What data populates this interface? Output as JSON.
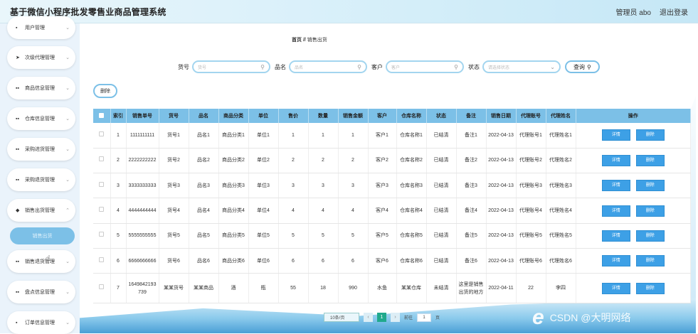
{
  "header": {
    "title": "基于微信小程序批发零售业商品管理系统",
    "admin": "管理员 abo",
    "logout": "退出登录"
  },
  "sidebar": {
    "items": [
      {
        "label": "用户管理",
        "icon": "user-icon",
        "glyph": "▪"
      },
      {
        "label": "次级代理管理",
        "icon": "paper-plane-icon",
        "glyph": "➤"
      },
      {
        "label": "商品信息管理",
        "icon": "grid-icon",
        "glyph": "▪▪"
      },
      {
        "label": "仓库信息管理",
        "icon": "grid-icon",
        "glyph": "▪▪"
      },
      {
        "label": "采购进货管理",
        "icon": "grid-icon",
        "glyph": "▪▪"
      },
      {
        "label": "采购退货管理",
        "icon": "grid-icon",
        "glyph": "▪▪"
      },
      {
        "label": "销售出货管理",
        "icon": "thumbs-up-icon",
        "glyph": "◆"
      },
      {
        "label": "销售退货管理",
        "icon": "grid-icon",
        "glyph": "▪▪"
      },
      {
        "label": "盘点信息管理",
        "icon": "grid-icon",
        "glyph": "▪▪"
      },
      {
        "label": "订单信息管理",
        "icon": "doc-icon",
        "glyph": "▪"
      }
    ],
    "active_sub": "销售出货"
  },
  "breadcrumb": {
    "home": "首页",
    "sep": "//",
    "current": "销售出货"
  },
  "search": {
    "f1_label": "货号",
    "f1_placeholder": "货号",
    "f2_label": "品名",
    "f2_placeholder": "品名",
    "f3_label": "客户",
    "f3_placeholder": "客户",
    "f4_label": "状态",
    "f4_placeholder": "请选择状态",
    "query": "查询"
  },
  "toolbar": {
    "delete": "删除"
  },
  "table": {
    "headers": [
      "索引",
      "销售单号",
      "货号",
      "品名",
      "商品分类",
      "单位",
      "售价",
      "数量",
      "销售金额",
      "客户",
      "仓库名称",
      "状态",
      "备注",
      "销售日期",
      "代理账号",
      "代理姓名",
      "操作"
    ],
    "rows": [
      [
        "1",
        "1111111111",
        "货号1",
        "品名1",
        "商品分类1",
        "单位1",
        "1",
        "1",
        "1",
        "客户1",
        "仓库名称1",
        "已结清",
        "备注1",
        "2022-04-13",
        "代理账号1",
        "代理姓名1"
      ],
      [
        "2",
        "2222222222",
        "货号2",
        "品名2",
        "商品分类2",
        "单位2",
        "2",
        "2",
        "2",
        "客户2",
        "仓库名称2",
        "已结清",
        "备注2",
        "2022-04-13",
        "代理账号2",
        "代理姓名2"
      ],
      [
        "3",
        "3333333333",
        "货号3",
        "品名3",
        "商品分类3",
        "单位3",
        "3",
        "3",
        "3",
        "客户3",
        "仓库名称3",
        "已结清",
        "备注3",
        "2022-04-13",
        "代理账号3",
        "代理姓名3"
      ],
      [
        "4",
        "4444444444",
        "货号4",
        "品名4",
        "商品分类4",
        "单位4",
        "4",
        "4",
        "4",
        "客户4",
        "仓库名称4",
        "已结清",
        "备注4",
        "2022-04-13",
        "代理账号4",
        "代理姓名4"
      ],
      [
        "5",
        "5555555555",
        "货号5",
        "品名5",
        "商品分类5",
        "单位5",
        "5",
        "5",
        "5",
        "客户5",
        "仓库名称5",
        "已结清",
        "备注5",
        "2022-04-13",
        "代理账号5",
        "代理姓名5"
      ],
      [
        "6",
        "6666666666",
        "货号6",
        "品名6",
        "商品分类6",
        "单位6",
        "6",
        "6",
        "6",
        "客户6",
        "仓库名称6",
        "已结清",
        "备注6",
        "2022-04-13",
        "代理账号6",
        "代理姓名6"
      ],
      [
        "7",
        "1649842193739",
        "某某货号",
        "某某商品",
        "酒",
        "瓶",
        "55",
        "18",
        "990",
        "水鱼",
        "某某仓库",
        "未结清",
        "这里是销售出货的地方",
        "2022-04-11",
        "22",
        "李四"
      ]
    ],
    "detail": "详情",
    "del": "删除"
  },
  "pagination": {
    "page_size": "10条/页",
    "prev": "‹",
    "page": "1",
    "next": "›",
    "goto": "前往",
    "goto_value": "1",
    "page_unit": "页"
  },
  "watermark": {
    "text": "CSDN @大明网络"
  }
}
